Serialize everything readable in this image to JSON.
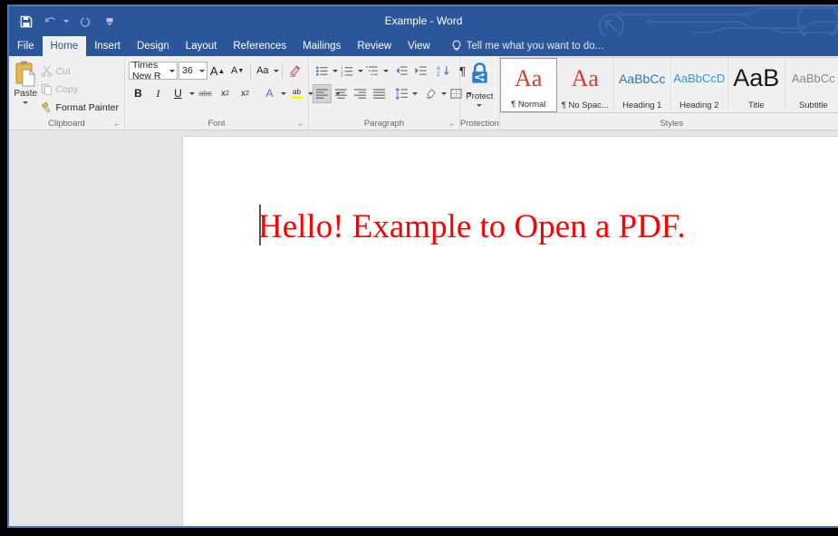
{
  "window": {
    "title": "Example - Word",
    "accent_color": "#2b579a",
    "border_color": "#4a78b8"
  },
  "quick_access": {
    "items": [
      {
        "name": "save-icon",
        "label": "Save",
        "enabled": true
      },
      {
        "name": "undo-icon",
        "label": "Undo",
        "enabled": false
      },
      {
        "name": "redo-icon",
        "label": "Redo",
        "enabled": false
      },
      {
        "name": "customize-quick-access-icon",
        "label": "Customize Quick Access Toolbar",
        "enabled": true
      }
    ]
  },
  "tabs": [
    {
      "label": "File",
      "active": false
    },
    {
      "label": "Home",
      "active": true
    },
    {
      "label": "Insert",
      "active": false
    },
    {
      "label": "Design",
      "active": false
    },
    {
      "label": "Layout",
      "active": false
    },
    {
      "label": "References",
      "active": false
    },
    {
      "label": "Mailings",
      "active": false
    },
    {
      "label": "Review",
      "active": false
    },
    {
      "label": "View",
      "active": false
    }
  ],
  "tell_me": {
    "icon": "lightbulb-icon",
    "placeholder": "Tell me what you want to do..."
  },
  "ribbon": {
    "clipboard": {
      "label": "Clipboard",
      "paste": {
        "label": "Paste",
        "icon": "clipboard-icon"
      },
      "items": [
        {
          "label": "Cut",
          "icon": "scissors-icon",
          "enabled": false
        },
        {
          "label": "Copy",
          "icon": "copy-icon",
          "enabled": false
        },
        {
          "label": "Format Painter",
          "icon": "paintbrush-icon",
          "enabled": true
        }
      ]
    },
    "font": {
      "label": "Font",
      "font_name": "Times New R",
      "font_size": "36",
      "row1": [
        {
          "name": "increase-font-size-icon",
          "glyph": "A˄"
        },
        {
          "name": "decrease-font-size-icon",
          "glyph": "Aˇ"
        },
        {
          "name": "change-case-icon",
          "glyph": "Aa"
        },
        {
          "name": "clear-formatting-icon",
          "glyph": "✐"
        }
      ],
      "row2": [
        {
          "name": "bold-icon",
          "glyph": "B"
        },
        {
          "name": "italic-icon",
          "glyph": "I"
        },
        {
          "name": "underline-icon",
          "glyph": "U"
        },
        {
          "name": "strikethrough-icon",
          "glyph": "abc"
        },
        {
          "name": "subscript-icon",
          "glyph": "x₂"
        },
        {
          "name": "superscript-icon",
          "glyph": "x²"
        },
        {
          "name": "text-effects-icon",
          "glyph": "A"
        },
        {
          "name": "text-highlight-color-icon",
          "glyph": "ab"
        },
        {
          "name": "font-color-icon",
          "glyph": "A"
        }
      ]
    },
    "paragraph": {
      "label": "Paragraph",
      "row1": [
        {
          "name": "bullets-icon"
        },
        {
          "name": "numbering-icon"
        },
        {
          "name": "multilevel-list-icon"
        },
        {
          "name": "decrease-indent-icon"
        },
        {
          "name": "increase-indent-icon"
        },
        {
          "name": "sort-icon"
        },
        {
          "name": "show-formatting-marks-icon",
          "glyph": "¶"
        }
      ],
      "row2": [
        {
          "name": "align-left-icon",
          "active": true
        },
        {
          "name": "align-center-icon",
          "active": false
        },
        {
          "name": "align-right-icon",
          "active": false
        },
        {
          "name": "justify-icon",
          "active": false
        },
        {
          "name": "line-spacing-icon",
          "active": false
        },
        {
          "name": "shading-icon",
          "active": false
        },
        {
          "name": "borders-icon",
          "active": false
        }
      ]
    },
    "protection": {
      "label": "Protection",
      "button_label": "Protect",
      "icon": "lock-share-icon"
    },
    "styles": {
      "label": "Styles",
      "items": [
        {
          "name": "Normal",
          "display": "¶ Normal",
          "preview": "Aa",
          "preview_color": "#e03a32",
          "preview_size": "26px",
          "selected": true
        },
        {
          "name": "No Spacing",
          "display": "¶ No Spac...",
          "preview": "Aa",
          "preview_color": "#e03a32",
          "preview_size": "26px",
          "selected": false
        },
        {
          "name": "Heading 1",
          "display": "Heading 1",
          "preview": "AaBbCc",
          "preview_color": "#2e74b5",
          "preview_size": "14px",
          "selected": false
        },
        {
          "name": "Heading 2",
          "display": "Heading 2",
          "preview": "AaBbCcD",
          "preview_color": "#2e9bd6",
          "preview_size": "13px",
          "selected": false
        },
        {
          "name": "Title",
          "display": "Title",
          "preview": "AaB",
          "preview_color": "#1a1a1a",
          "preview_size": "27px",
          "selected": false
        },
        {
          "name": "Subtitle",
          "display": "Subtitle",
          "preview": "AaBbCc",
          "preview_color": "#888888",
          "preview_size": "13px",
          "selected": false
        }
      ]
    }
  },
  "document": {
    "text": "Hello! Example to Open a PDF.",
    "text_color": "#ff0000",
    "font": "Times New Roman",
    "font_size": "36"
  }
}
